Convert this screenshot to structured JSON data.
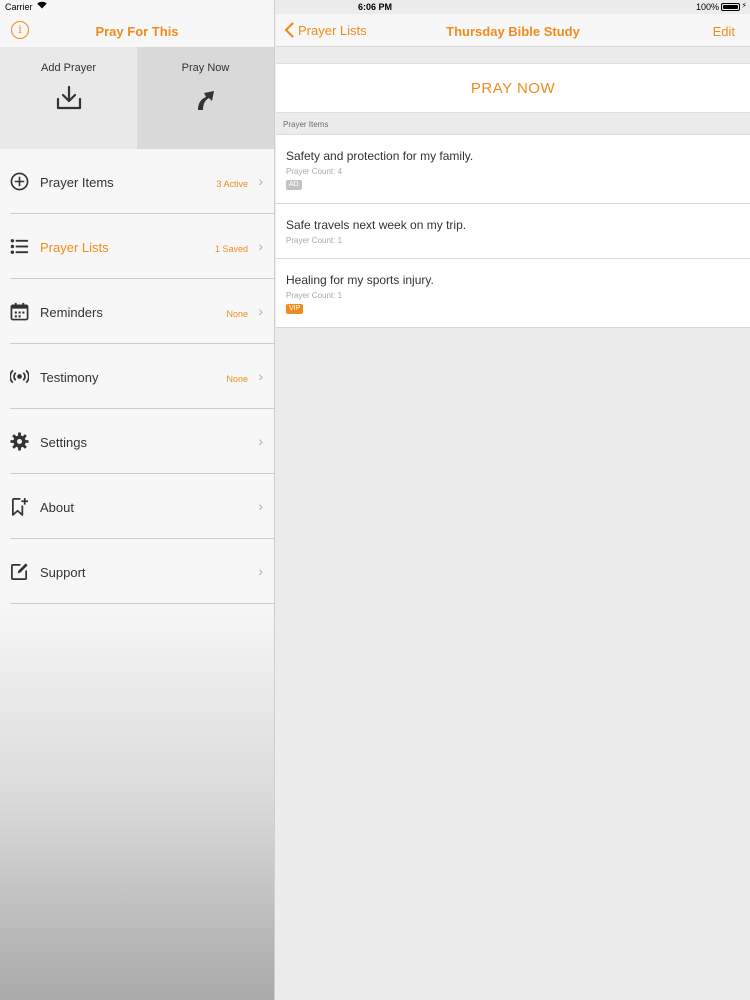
{
  "status": {
    "carrier": "Carrier",
    "time": "6:06 PM",
    "battery": "100%"
  },
  "sidebar": {
    "title": "Pray For This",
    "info_glyph": "i",
    "actions": [
      {
        "label": "Add Prayer",
        "icon": "download-icon"
      },
      {
        "label": "Pray Now",
        "icon": "arrow-up-icon"
      }
    ],
    "items": [
      {
        "label": "Prayer Items",
        "badge": "3 Active",
        "icon": "plus-circle-icon"
      },
      {
        "label": "Prayer Lists",
        "badge": "1 Saved",
        "icon": "list-icon",
        "active": true
      },
      {
        "label": "Reminders",
        "badge": "None",
        "icon": "calendar-icon"
      },
      {
        "label": "Testimony",
        "badge": "None",
        "icon": "broadcast-icon"
      },
      {
        "label": "Settings",
        "badge": "",
        "icon": "gear-icon"
      },
      {
        "label": "About",
        "badge": "",
        "icon": "bookmark-plus-icon"
      },
      {
        "label": "Support",
        "badge": "",
        "icon": "edit-icon"
      }
    ],
    "chevron": "›"
  },
  "main": {
    "back_label": "Prayer Lists",
    "title": "Thursday Bible Study",
    "edit_label": "Edit",
    "pray_now": "PRAY NOW",
    "section_header": "Prayer Items",
    "rows": [
      {
        "title": "Safety and protection for my family.",
        "count": "Prayer Count: 4",
        "tag": "AD"
      },
      {
        "title": "Safe travels next week on my trip.",
        "count": "Prayer Count: 1",
        "tag": ""
      },
      {
        "title": "Healing for my sports injury.",
        "count": "Prayer Count: 1",
        "tag": "VIP"
      }
    ]
  },
  "colors": {
    "accent": "#f08c1e",
    "tag_gray": "#c3c3c3"
  }
}
